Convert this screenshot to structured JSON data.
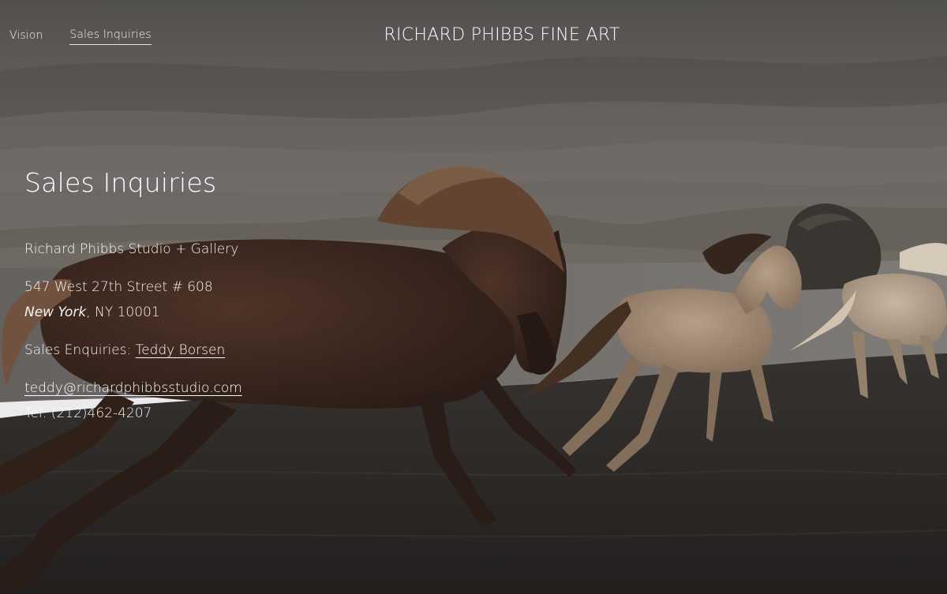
{
  "nav": {
    "items": [
      {
        "label": "Vision"
      },
      {
        "label": "Sales Inquiries"
      }
    ],
    "active_index": 1
  },
  "brand": {
    "title": "RICHARD PHIBBS FINE ART"
  },
  "content": {
    "heading": "Sales Inquiries",
    "studio_name": "Richard Phibbs Studio + Gallery",
    "address_line1": "547 West 27th Street  # 608",
    "city": "New York",
    "state_zip": ", NY 10001",
    "sales_label": "Sales Enquiries: ",
    "sales_contact": "Teddy Borsen",
    "email": "teddy@richardphibbsstudio.com",
    "phone": "Tel: (212)462-4207"
  },
  "background": {
    "subject": "horses running on black sand beach by a lake",
    "colors": {
      "sky": "#6b6864",
      "ground": "#2f2c29",
      "horse_dark": "#3f2a21",
      "horse_light": "#b8a189"
    }
  }
}
